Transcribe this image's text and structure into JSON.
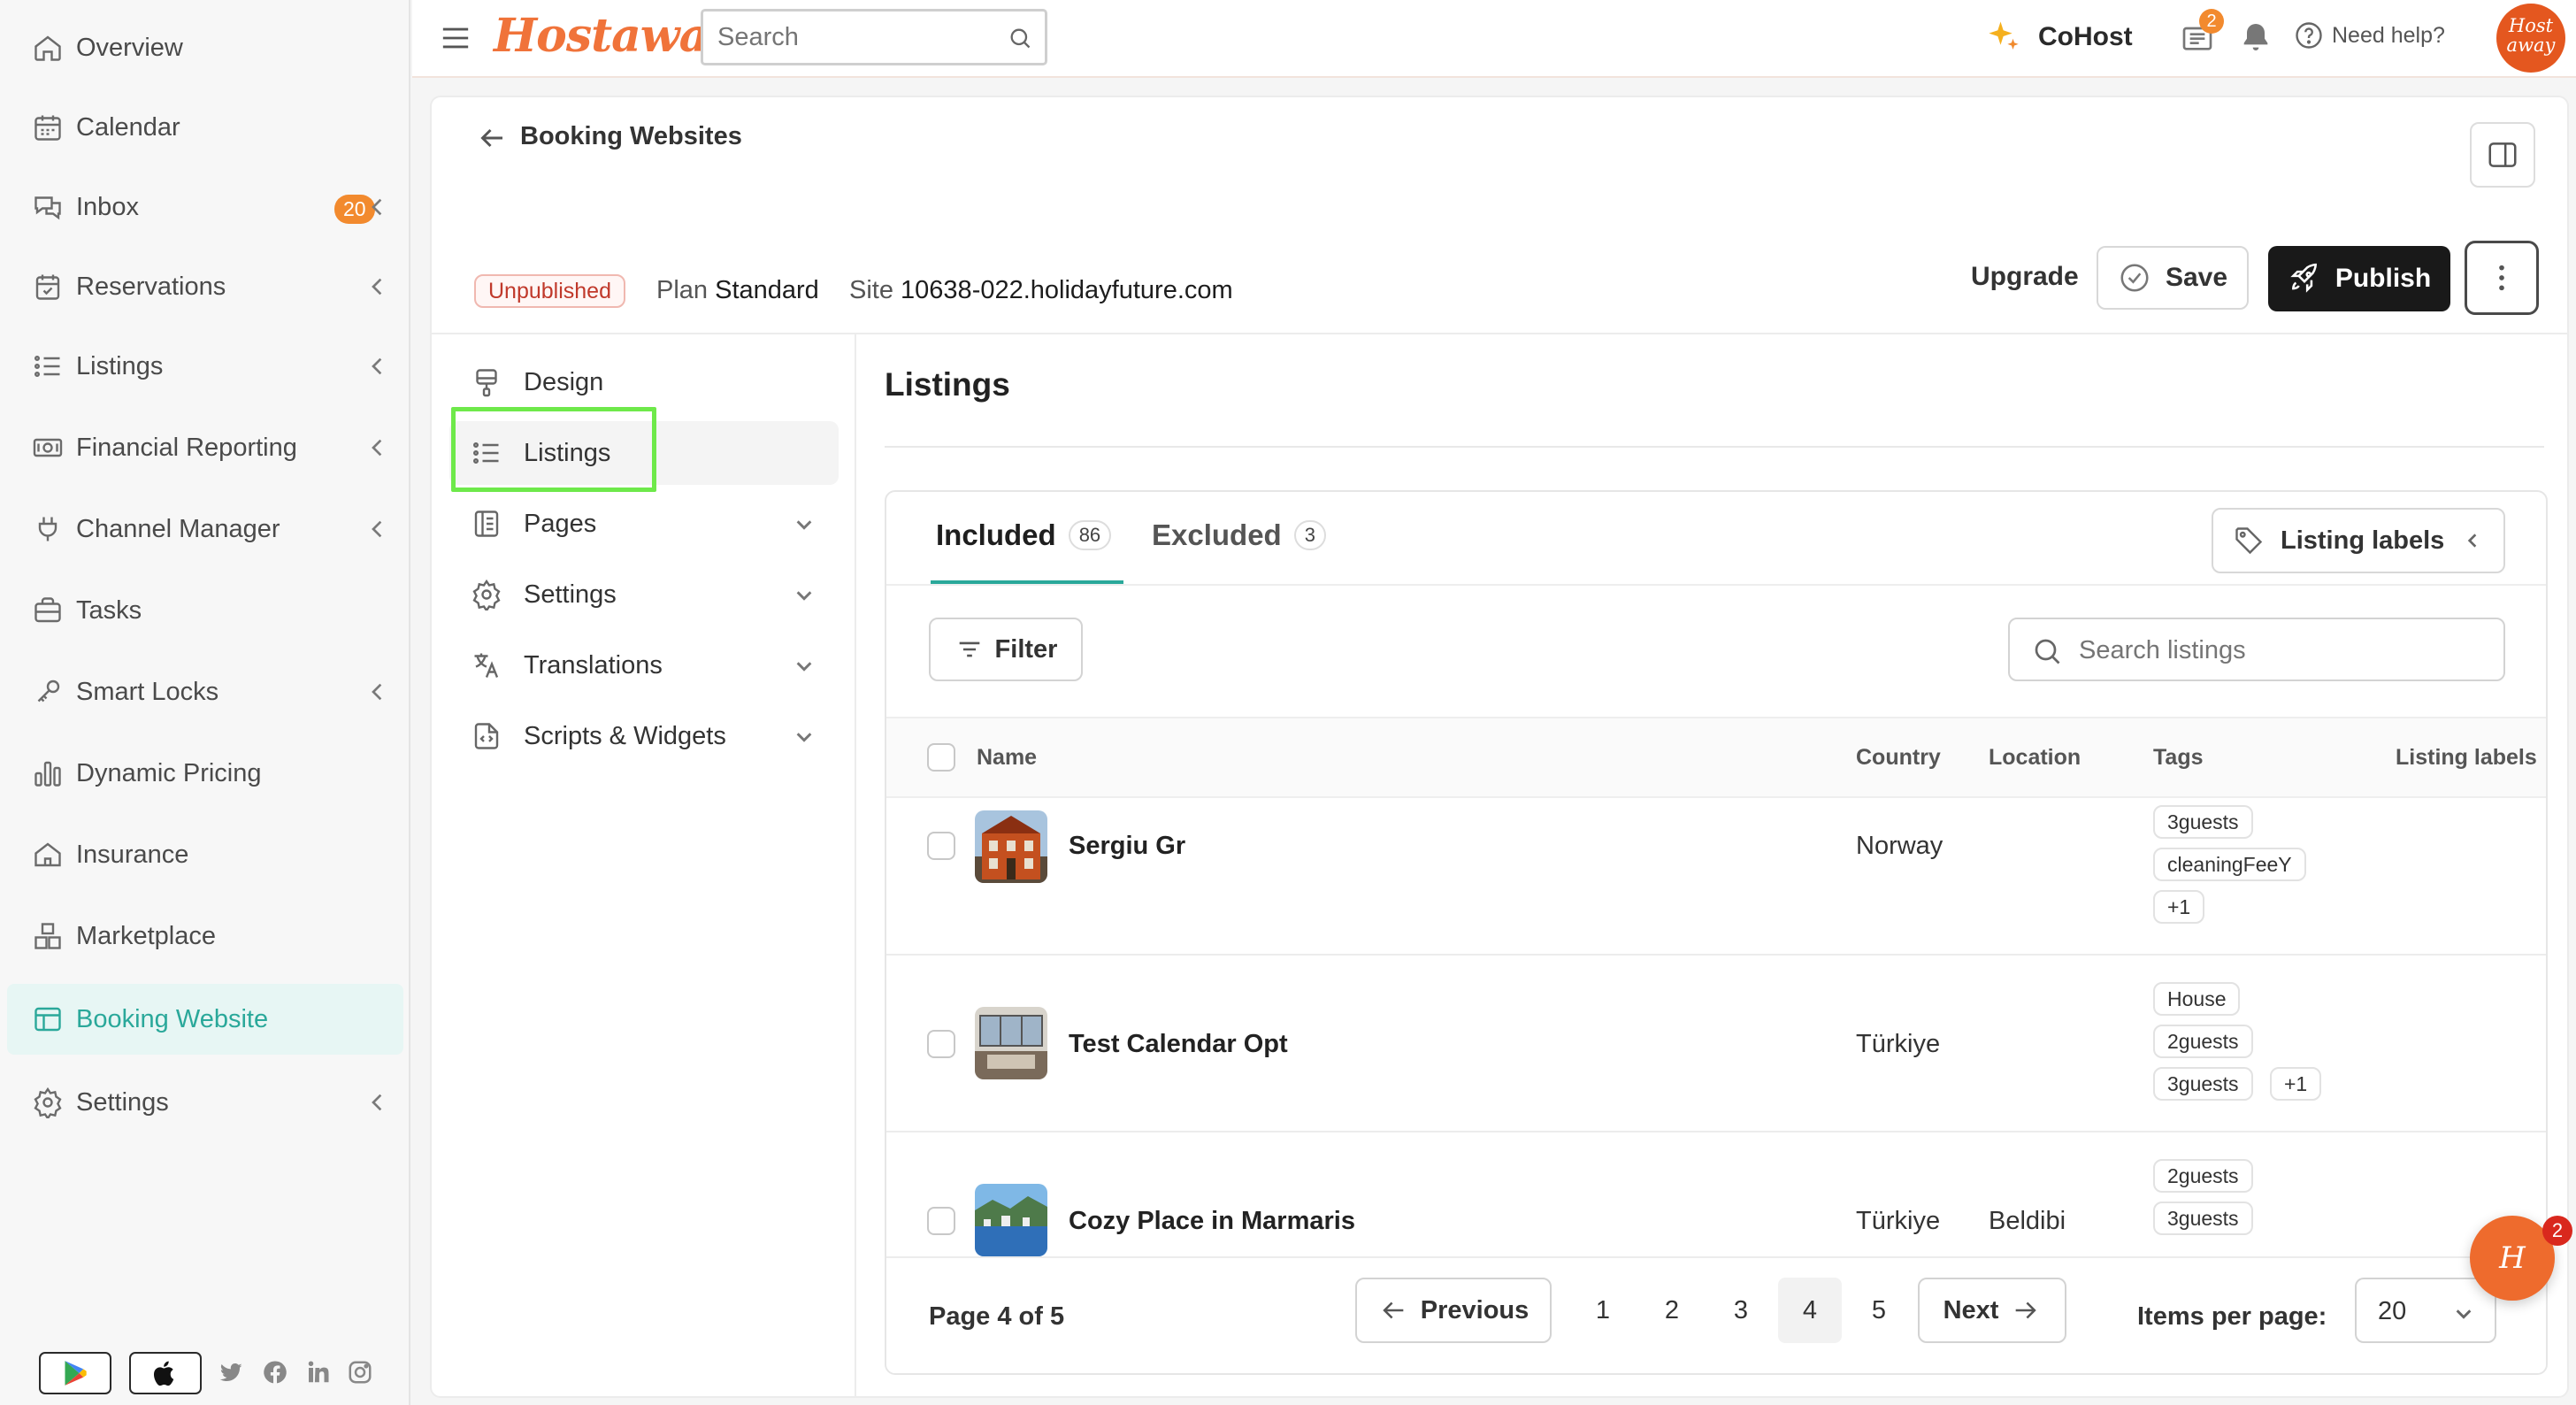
{
  "sidebar": {
    "items": [
      {
        "label": "Overview",
        "icon": "home-icon"
      },
      {
        "label": "Calendar",
        "icon": "calendar-icon"
      },
      {
        "label": "Inbox",
        "icon": "chat-icon",
        "badge": "20"
      },
      {
        "label": "Reservations",
        "icon": "reservation-icon"
      },
      {
        "label": "Listings",
        "icon": "list-icon"
      },
      {
        "label": "Financial Reporting",
        "icon": "money-icon"
      },
      {
        "label": "Channel Manager",
        "icon": "plug-icon"
      },
      {
        "label": "Tasks",
        "icon": "briefcase-icon"
      },
      {
        "label": "Smart Locks",
        "icon": "key-icon"
      },
      {
        "label": "Dynamic Pricing",
        "icon": "bar-chart-icon"
      },
      {
        "label": "Insurance",
        "icon": "shield-home-icon"
      },
      {
        "label": "Marketplace",
        "icon": "boxes-icon"
      },
      {
        "label": "Booking Website",
        "icon": "website-icon",
        "active": true
      },
      {
        "label": "Settings",
        "icon": "gear-icon"
      }
    ]
  },
  "topbar": {
    "logo": "Hostaway",
    "search_placeholder": "Search",
    "cohost_label": "CoHost",
    "news_badge": "2",
    "help_label": "Need help?",
    "avatar_line1": "Host",
    "avatar_line2": "away"
  },
  "header": {
    "title": "Booking Websites",
    "status": "Unpublished",
    "plan_label": "Plan",
    "plan_value": "Standard",
    "site_label": "Site",
    "site_value": "10638-022.holidayfuture.com",
    "upgrade_label": "Upgrade",
    "save_label": "Save",
    "publish_label": "Publish"
  },
  "subnav": {
    "items": [
      {
        "label": "Design",
        "icon": "brush-icon"
      },
      {
        "label": "Listings",
        "icon": "list-icon",
        "active": true
      },
      {
        "label": "Pages",
        "icon": "pages-icon"
      },
      {
        "label": "Settings",
        "icon": "gear-icon"
      },
      {
        "label": "Translations",
        "icon": "translate-icon"
      },
      {
        "label": "Scripts & Widgets",
        "icon": "code-file-icon"
      }
    ]
  },
  "content": {
    "title": "Listings",
    "tabs": [
      {
        "label": "Included",
        "count": "86"
      },
      {
        "label": "Excluded",
        "count": "3"
      }
    ],
    "listing_labels_button": "Listing labels",
    "filter_label": "Filter",
    "search_placeholder": "Search listings",
    "columns": [
      "Name",
      "Country",
      "Location",
      "Tags",
      "Listing labels"
    ],
    "rows": [
      {
        "name": "Sergiu Gr",
        "country": "Norway",
        "location": "",
        "tags": [
          "3guests",
          "cleaningFeeY",
          "+1"
        ]
      },
      {
        "name": "Test Calendar Opt",
        "country": "Türkiye",
        "location": "",
        "tags": [
          "House",
          "2guests",
          "3guests",
          "+1"
        ]
      },
      {
        "name": "Cozy Place in Marmaris",
        "country": "Türkiye",
        "location": "Beldibi",
        "tags": [
          "2guests",
          "3guests"
        ]
      }
    ]
  },
  "pagination": {
    "page_info": "Page 4 of 5",
    "previous_label": "Previous",
    "next_label": "Next",
    "pages": [
      "1",
      "2",
      "3",
      "4",
      "5"
    ],
    "current_page": "4",
    "items_per_page_label": "Items per page:",
    "items_per_page_value": "20"
  },
  "chat": {
    "badge": "2",
    "glyph": "H"
  },
  "colors": {
    "brand_orange": "#f0733a",
    "accent_teal": "#2aa89a",
    "highlight_green": "#6ee94a",
    "publish_black": "#191919"
  }
}
